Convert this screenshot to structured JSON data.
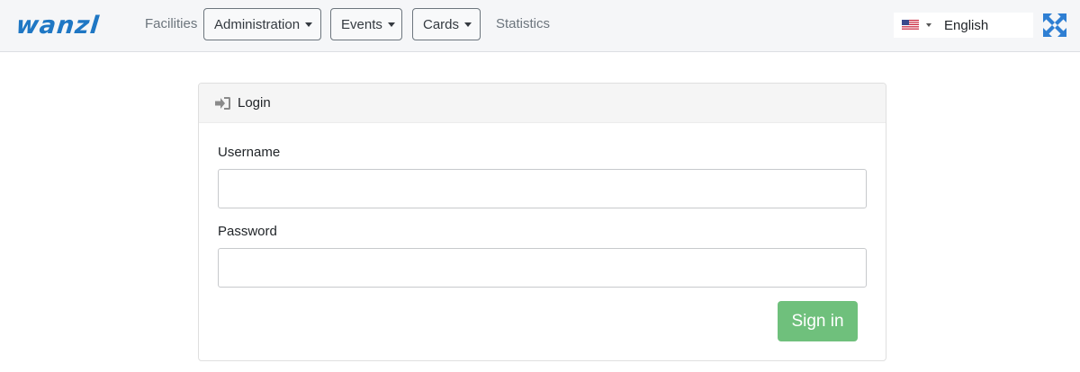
{
  "brand": {
    "logo_text": "wanzl",
    "color": "#1f77c4"
  },
  "nav": {
    "facilities": "Facilities",
    "administration": "Administration",
    "events": "Events",
    "cards": "Cards",
    "statistics": "Statistics"
  },
  "language": {
    "selected": "English",
    "flag_icon": "us-flag-icon"
  },
  "expand_icon": "expand-arrows-icon",
  "login": {
    "header_icon": "sign-in-icon",
    "title": "Login",
    "username_label": "Username",
    "username_value": "",
    "password_label": "Password",
    "password_value": "",
    "submit_label": "Sign in",
    "submit_color": "#6fc07c"
  }
}
